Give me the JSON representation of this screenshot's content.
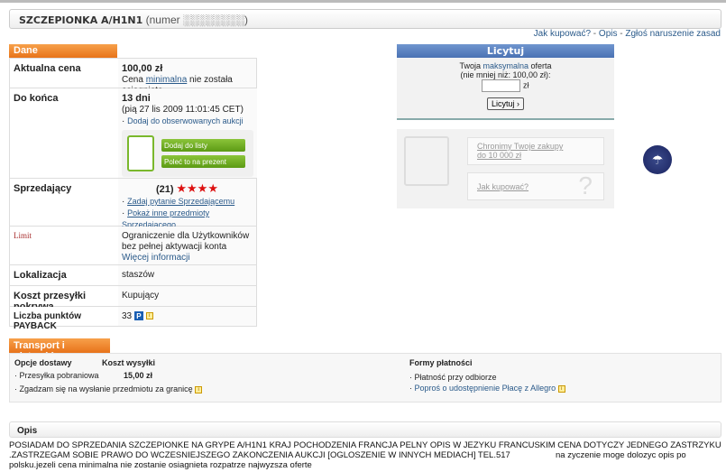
{
  "title": {
    "name": "SZCZEPIONKA A/H1N1",
    "number": "(numer ░░░░░░░░)"
  },
  "toplinks": [
    "Jak kupować?",
    "Opis",
    "Zgłoś naruszenie zasad"
  ],
  "dane": {
    "header": "Dane",
    "price_label": "Aktualna cena",
    "price": "100,00 zł",
    "price_note_pre": "Cena ",
    "price_note_link": "minimalna",
    "price_note_post": " nie została osiągnięta.",
    "end_label": "Do końca",
    "end_days": "13 dni",
    "end_date": "(pią 27 lis 2009 11:01:45 CET)",
    "watch": "Dodaj do obserwowanych aukcji",
    "gift_add": "Dodaj do listy prezentów",
    "gift_recommend": "Poleć to na prezent",
    "seller_label": "Sprzedający",
    "seller_rating": "(21)",
    "seller_stars": "★★★★",
    "ask": "Zadaj pytanie Sprzedającemu",
    "other": "Pokaż inne przedmioty Sprzedającego",
    "limit_label": "Limit",
    "limit_text1": "Ograniczenie dla Użytkowników",
    "limit_text2": "bez pełnej aktywacji konta",
    "limit_more": "Więcej informacji",
    "loc_label": "Lokalizacja",
    "loc": "staszów",
    "ship_label": "Koszt przesyłki pokrywa",
    "ship": "Kupujący",
    "payback_label": "Liczba punktów PAYBACK",
    "payback": "33"
  },
  "bid": {
    "header": "Licytuj",
    "line1_pre": "Twoja ",
    "line1_link": "maksymalna",
    "line1_post": " oferta",
    "line2": "(nie mniej niż: 100,00 zł):",
    "currency": "zł",
    "input_value": "",
    "button": "Licytuj ›"
  },
  "promo": {
    "protect": "Chronimy Twoje zakupy do 10 000 zł",
    "howto": "Jak kupować?"
  },
  "transport": {
    "header": "Transport i płatność",
    "col_options": "Opcje dostawy",
    "col_cost": "Koszt wysyłki",
    "option1": "Przesyłka pobraniowa",
    "option1_cost": "15,00 zł",
    "abroad": "Zgadzam się na wysłanie przedmiotu za granicę",
    "pay_header": "Formy płatności",
    "pay1": "Płatność przy odbiorze",
    "pay2": "Poproś o udostępnienie Płacę z Allegro"
  },
  "opis": {
    "header": "Opis",
    "text": "POSIADAM DO SPRZEDANIA SZCZEPIONKE NA GRYPE A/H1N1 KRAJ POCHODZENIA FRANCJA PELNY OPIS W JEZYKU FRANCUSKIM CENA DOTYCZY JEDNEGO ZASTRZYKU .ZASTRZEGAM SOBIE PRAWO DO WCZESNIEJSZEGO ZAKONCZENIA AUKCJI [OGLOSZENIE W INNYCH MEDIACH] TEL.517                   na zyczenie moge dolozyc opis po polsku.jezeli cena minimalna nie zostanie osiagnieta rozpatrze najwyzsza oferte"
  }
}
